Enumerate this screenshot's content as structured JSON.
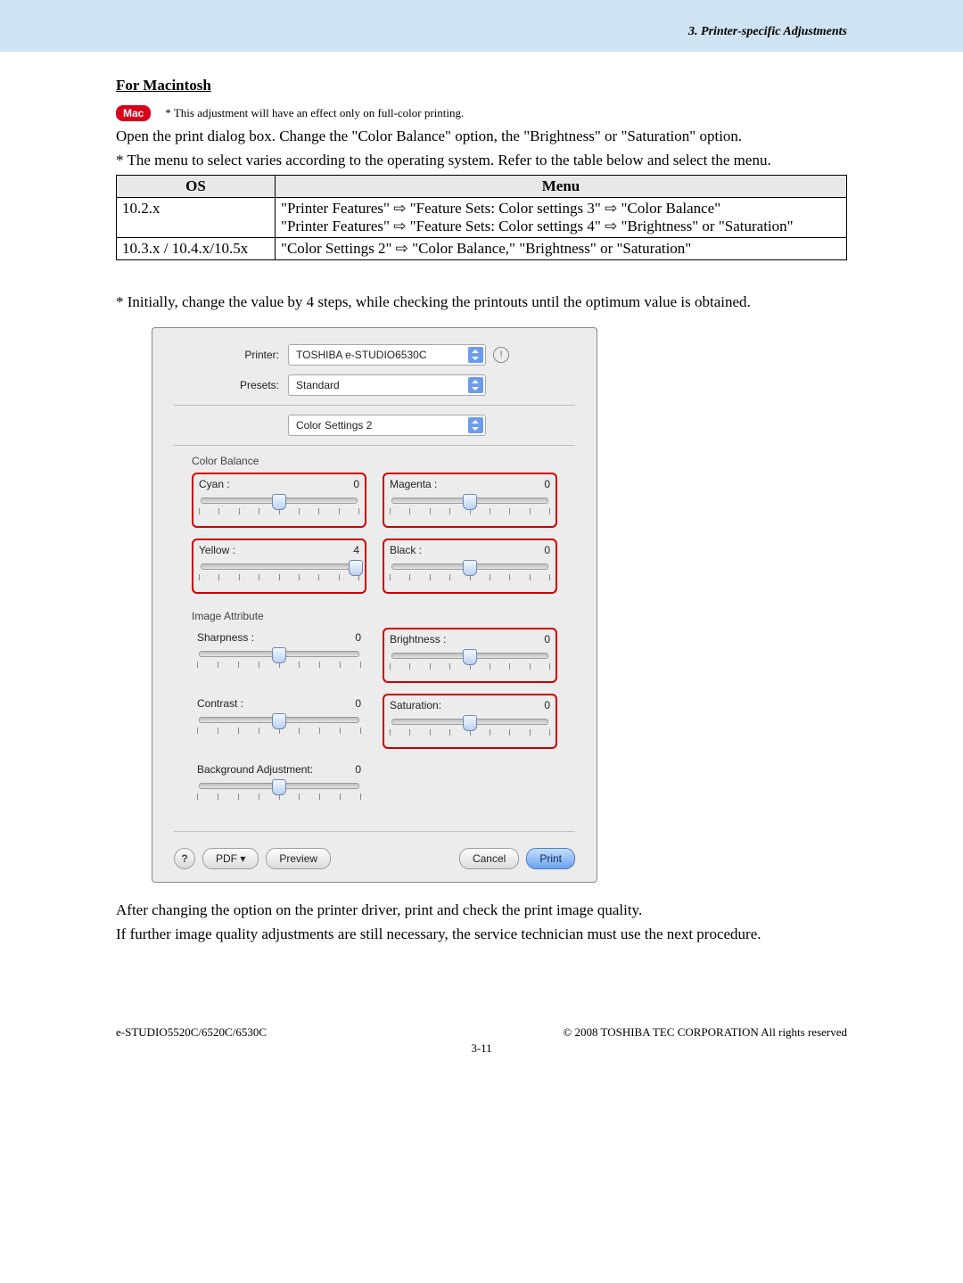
{
  "header": {
    "chapter": "3. Printer-specific Adjustments"
  },
  "section_title": "For Macintosh",
  "mac_badge": "Mac",
  "mac_note": "* This adjustment will have an effect only on full-color printing.",
  "intro": "Open the print dialog box.  Change the \"Color Balance\" option, the \"Brightness\" or \"Saturation\" option.",
  "menu_note": "* The menu to select varies according to the operating system.  Refer to the table below and select the menu.",
  "table": {
    "headers": [
      "OS",
      "Menu"
    ],
    "rows": [
      {
        "os": "10.2.x",
        "menu": "\"Printer Features\" ⇨ \"Feature Sets: Color settings 3\" ⇨ \"Color Balance\"\n\"Printer Features\" ⇨ \"Feature Sets: Color settings 4\" ⇨ \"Brightness\" or \"Saturation\""
      },
      {
        "os": "10.3.x / 10.4.x/10.5x",
        "menu": "\"Color Settings 2\" ⇨ \"Color Balance,\" \"Brightness\" or \"Saturation\""
      }
    ]
  },
  "step_note": "* Initially, change the value by 4 steps, while checking the printouts until the optimum value is obtained.",
  "dialog": {
    "printer_label": "Printer:",
    "printer_value": "TOSHIBA e-STUDIO6530C",
    "presets_label": "Presets:",
    "presets_value": "Standard",
    "pane_value": "Color Settings 2",
    "section_cb": "Color Balance",
    "section_ia": "Image Attribute",
    "sliders": {
      "cyan": {
        "label": "Cyan :",
        "value": "0",
        "pos": 50,
        "highlight": true
      },
      "magenta": {
        "label": "Magenta :",
        "value": "0",
        "pos": 50,
        "highlight": true
      },
      "yellow": {
        "label": "Yellow :",
        "value": "4",
        "pos": 100,
        "highlight": true
      },
      "black": {
        "label": "Black :",
        "value": "0",
        "pos": 50,
        "highlight": true
      },
      "sharpness": {
        "label": "Sharpness :",
        "value": "0",
        "pos": 50,
        "highlight": false
      },
      "brightness": {
        "label": "Brightness :",
        "value": "0",
        "pos": 50,
        "highlight": true
      },
      "contrast": {
        "label": "Contrast :",
        "value": "0",
        "pos": 50,
        "highlight": false
      },
      "saturation": {
        "label": "Saturation:",
        "value": "0",
        "pos": 50,
        "highlight": true
      },
      "background": {
        "label": "Background Adjustment:",
        "value": "0",
        "pos": 50,
        "highlight": false
      }
    },
    "buttons": {
      "pdf": "PDF ▾",
      "preview": "Preview",
      "cancel": "Cancel",
      "print": "Print",
      "help": "?"
    }
  },
  "after_text1": "After changing the option on the printer driver, print and check the print image quality.",
  "after_text2": "If further image quality adjustments are still necessary, the service technician must use the next procedure.",
  "footer": {
    "left": "e-STUDIO5520C/6520C/6530C",
    "right": "© 2008 TOSHIBA TEC CORPORATION All rights reserved",
    "center": "3-11"
  }
}
